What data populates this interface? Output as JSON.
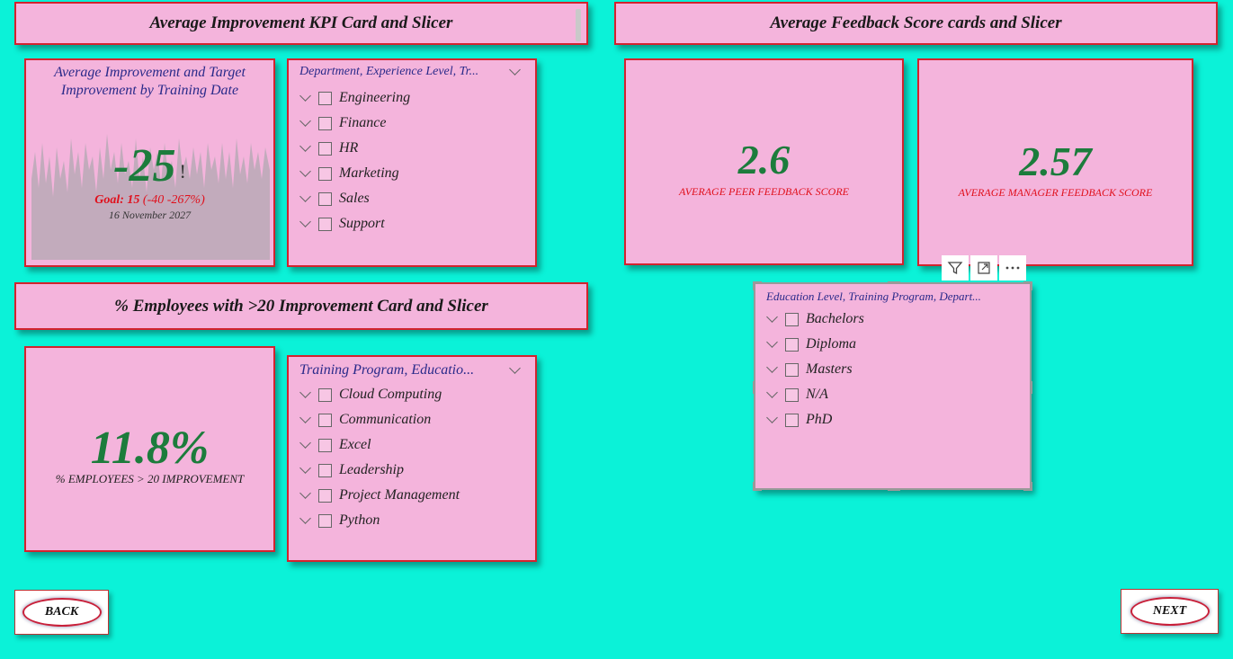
{
  "sections": {
    "kpi_header": "Average Improvement KPI Card and Slicer",
    "feedback_header": "Average Feedback Score cards and Slicer",
    "employees_header": "% Employees with >20 Improvement Card and Slicer"
  },
  "kpi_card": {
    "title": "Average Improvement and Target Improvement by Training Date",
    "value": "-25",
    "indicator": "!",
    "goal_label": "Goal: 15",
    "goal_detail": "(-40 -267%)",
    "date": "16 November 2027"
  },
  "slicer_department": {
    "header": "Department, Experience Level, Tr...",
    "items": [
      "Engineering",
      "Finance",
      "HR",
      "Marketing",
      "Sales",
      "Support"
    ]
  },
  "feedback_cards": {
    "peer": {
      "value": "2.6",
      "label": "AVERAGE PEER FEEDBACK SCORE"
    },
    "manager": {
      "value": "2.57",
      "label": "AVERAGE MANAGER FEEDBACK SCORE"
    }
  },
  "slicer_education": {
    "header": "Education Level, Training Program, Depart...",
    "items": [
      "Bachelors",
      "Diploma",
      "Masters",
      "N/A",
      "PhD"
    ]
  },
  "visual_toolbar": {
    "icons": [
      "filter-icon",
      "focus-mode-icon",
      "more-options-icon"
    ]
  },
  "employees_card": {
    "value": "11.8%",
    "label": "% EMPLOYEES > 20 IMPROVEMENT"
  },
  "slicer_training": {
    "header": "Training Program, Educatio...",
    "items": [
      "Cloud Computing",
      "Communication",
      "Excel",
      "Leadership",
      "Project Management",
      "Python"
    ]
  },
  "nav": {
    "back": "BACK",
    "next": "NEXT"
  },
  "colors": {
    "canvas": "#0bf2d8",
    "card": "#f4b4dc",
    "border": "#d2232e",
    "value_green": "#1c7c3c",
    "label_red": "#e0101c",
    "title_navy": "#2a2a8a"
  }
}
